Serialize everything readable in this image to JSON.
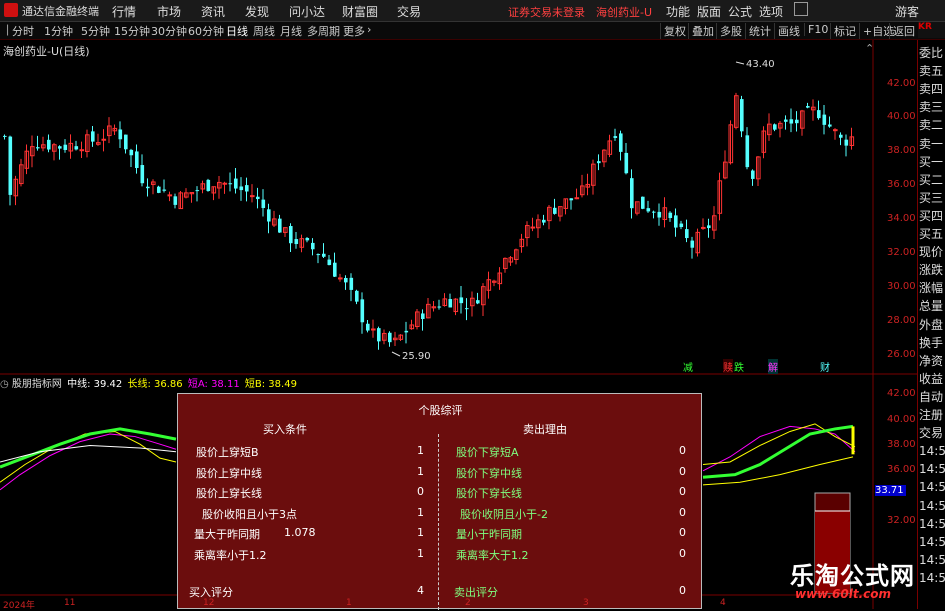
{
  "app": {
    "title": "通达信金融终端",
    "logo_icon": "tdx-logo-icon"
  },
  "menu": [
    "行情",
    "市场",
    "资讯",
    "发现",
    "问小达",
    "财富圈",
    "交易"
  ],
  "alert_text": "证券交易未登录",
  "stock_name": "海创药业-U",
  "right_menu": [
    "功能",
    "版面",
    "公式",
    "选项"
  ],
  "user": "游客",
  "periods": [
    "分时",
    "1分钟",
    "5分钟",
    "15分钟",
    "30分钟",
    "60分钟",
    "日线",
    "周线",
    "月线",
    "多周期",
    "更多"
  ],
  "active_period": "日线",
  "toolbar_right": [
    "复权",
    "叠加",
    "多股",
    "统计",
    "画线",
    "F10",
    "标记",
    "+自选",
    "返回"
  ],
  "chart_title": "海创药业-U(日线)",
  "sidebar": [
    "委比",
    "卖五",
    "卖四",
    "卖三",
    "卖二",
    "卖一",
    "买一",
    "买二",
    "买三",
    "买四",
    "买五",
    "现价",
    "涨跌",
    "涨幅",
    "总量",
    "外盘",
    "换手",
    "净资",
    "收益",
    "自动",
    "注册",
    "交易",
    "14:5",
    "14:5",
    "14:5",
    "14:5",
    "14:5",
    "14:5",
    "14:5",
    "14:5"
  ],
  "price_axis": [
    "42.00",
    "40.00",
    "38.00",
    "36.00",
    "34.00",
    "32.00",
    "30.00",
    "28.00",
    "26.00"
  ],
  "ind_axis": [
    "42.00",
    "40.00",
    "38.00",
    "36.00",
    "34.00",
    "32.00"
  ],
  "current_price_tag": "33.71",
  "high_label": "43.40",
  "low_label": "25.90",
  "markers": {
    "jian": "减",
    "shu": "赎",
    "die": "跌",
    "jie": "解",
    "cai": "财"
  },
  "indicator": {
    "name": "股朋指标网",
    "zhong": "中线: 39.42",
    "chang": "长线: 36.86",
    "duanA": "短A: 38.11",
    "duanB": "短B: 38.49"
  },
  "popup": {
    "title": "个股综评",
    "buy_header": "买入条件",
    "sell_header": "卖出理由",
    "buy_rows": [
      {
        "label": "股价上穿短B",
        "extra": "",
        "value": "1"
      },
      {
        "label": "股价上穿中线",
        "extra": "",
        "value": "1"
      },
      {
        "label": "股价上穿长线",
        "extra": "",
        "value": "0"
      },
      {
        "label": "股价收阳且小于3点",
        "extra": "",
        "value": "1"
      },
      {
        "label": "量大于昨同期",
        "extra": "1.078",
        "value": "1"
      },
      {
        "label": "乘离率小于1.2",
        "extra": "",
        "value": "1"
      }
    ],
    "sell_rows": [
      {
        "label": "股价下穿短A",
        "value": "0"
      },
      {
        "label": "股价下穿中线",
        "value": "0"
      },
      {
        "label": "股价下穿长线",
        "value": "0"
      },
      {
        "label": "股价收阴且小于-2",
        "value": "0"
      },
      {
        "label": "量小于昨同期",
        "value": "0"
      },
      {
        "label": "乘离率大于1.2",
        "value": "0"
      }
    ],
    "buy_score_label": "买入评分",
    "buy_score": "4",
    "sell_score_label": "卖出评分",
    "sell_score": "0"
  },
  "dates": [
    "2024年",
    "11",
    "12",
    "1",
    "2",
    "3",
    "4"
  ],
  "watermark": {
    "cn": "乐淘公式网",
    "url": "www.60lt.com"
  },
  "colors": {
    "up": "#ff3333",
    "down": "#54ffff",
    "zhong": "#ffffff",
    "chang": "#ffff00",
    "duanA": "#ff00ff",
    "duanB": "#ffff00",
    "ma_thick": "#33ff33"
  }
}
